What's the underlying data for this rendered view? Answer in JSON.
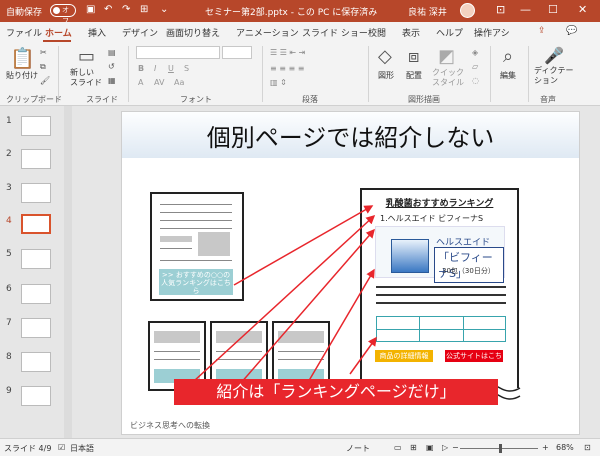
{
  "titlebar": {
    "autosave": "自動保存",
    "autosave_state": "オフ",
    "title": "セミナー第2部.pptx - この PC に保存済み",
    "user": "良祐 深井",
    "min": "—",
    "max": "☐",
    "close": "✕"
  },
  "tabs": [
    "ファイル",
    "ホーム",
    "挿入",
    "デザイン",
    "画面切り替え",
    "アニメーション",
    "スライド ショー",
    "校閲",
    "表示",
    "ヘルプ",
    "操作アシ"
  ],
  "ribbon": {
    "paste": "貼り付け",
    "new_slide": "新しい\nスライド",
    "font_size": "",
    "shape": "図形",
    "arrange": "配置",
    "quick_style": "クイック\nスタイル",
    "edit": "編集",
    "dictation": "ディクテー\nション",
    "groups": [
      "クリップボード",
      "スライド",
      "フォント",
      "段落",
      "図形描画",
      "音声"
    ]
  },
  "thumbs": [
    "1",
    "2",
    "3",
    "4",
    "5",
    "6",
    "7",
    "8",
    "9"
  ],
  "slide": {
    "title": "個別ページでは紹介しない",
    "teal_box": ">> おすすめの○○の人気ランキングはこちら",
    "ranking_title": "乳酸菌おすすめランキング",
    "ranking_item": "1.ヘルスエイド ビフィーナS",
    "product_logo": "ヘルスエイド",
    "product_name": "「ビフィーナS」",
    "product_sub": "30包（30日分）",
    "btn_detail": "商品の詳細情報",
    "btn_official": "公式サイトはこちら",
    "banner": "紹介は「ランキングページだけ」",
    "footer": "ビジネス思考への転換"
  },
  "status": {
    "slide": "スライド 4/9",
    "lang": "日本語",
    "note": "ノート",
    "zoom": "68%"
  }
}
